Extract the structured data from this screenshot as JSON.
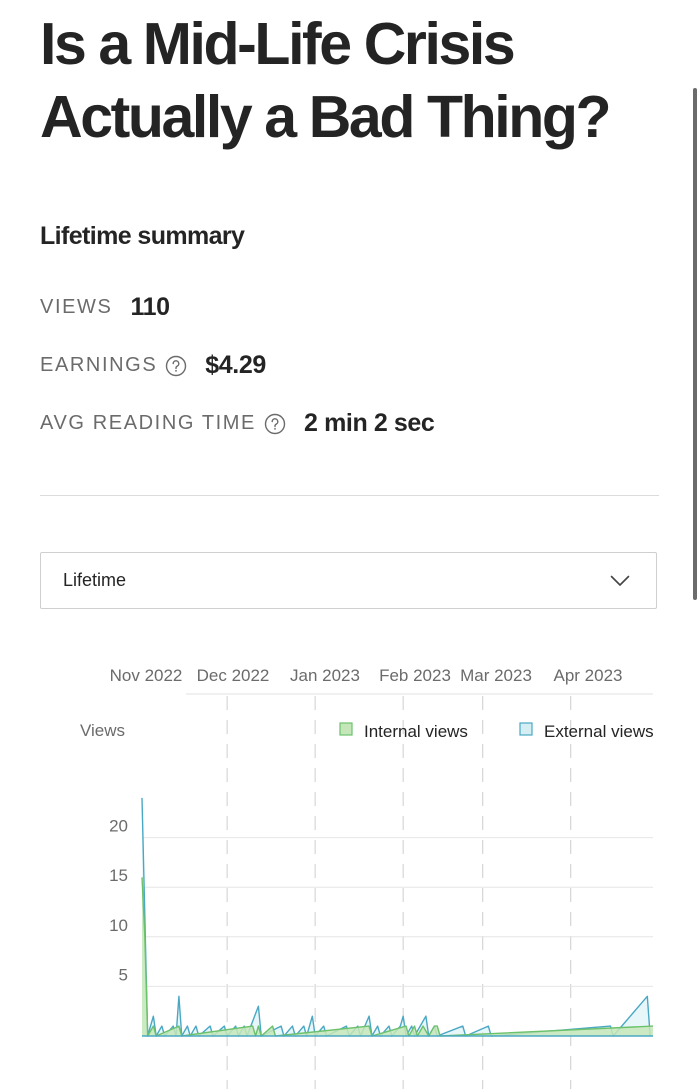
{
  "article": {
    "title": "Is a Mid-Life Crisis Actually a Bad Thing?"
  },
  "summary": {
    "heading": "Lifetime summary",
    "views_label": "VIEWS",
    "views_value": "110",
    "earnings_label": "EARNINGS",
    "earnings_value": "$4.29",
    "avg_label": "AVG READING TIME",
    "avg_value": "2 min 2 sec",
    "help_icon": "question-circle-icon"
  },
  "range_select": {
    "value": "Lifetime",
    "icon": "chevron-down-icon"
  },
  "colors": {
    "internal_fill": "#c5e6b8",
    "internal_stroke": "#6cc16c",
    "external_fill": "#d4eef4",
    "external_stroke": "#4aa8c4"
  },
  "chart_data": {
    "type": "area",
    "x_tick_labels": [
      "Nov 2022",
      "Dec 2022",
      "Jan 2023",
      "Feb 2023",
      "Mar 2023",
      "Apr 2023"
    ],
    "ylabel": "Views",
    "y_ticks": [
      5,
      10,
      15,
      20
    ],
    "ylim": [
      0,
      25
    ],
    "grid": true,
    "legend_position": "top-right",
    "x_start": "2022-11-01",
    "x_end": "2023-04-30",
    "series": [
      {
        "name": "Internal views",
        "points": [
          [
            "2022-11-01",
            16
          ],
          [
            "2022-11-02",
            10
          ],
          [
            "2022-11-03",
            0
          ],
          [
            "2022-11-05",
            1
          ],
          [
            "2022-11-06",
            0
          ],
          [
            "2022-11-14",
            1
          ],
          [
            "2022-11-15",
            0
          ],
          [
            "2022-12-10",
            1
          ],
          [
            "2022-12-11",
            0
          ],
          [
            "2022-12-12",
            1
          ],
          [
            "2022-12-13",
            0
          ],
          [
            "2022-12-17",
            1
          ],
          [
            "2022-12-18",
            0
          ],
          [
            "2023-01-20",
            1
          ],
          [
            "2023-01-21",
            0
          ],
          [
            "2023-02-02",
            1
          ],
          [
            "2023-02-03",
            0
          ],
          [
            "2023-02-05",
            1
          ],
          [
            "2023-02-06",
            0
          ],
          [
            "2023-02-08",
            1
          ],
          [
            "2023-02-10",
            0
          ],
          [
            "2023-02-12",
            1
          ],
          [
            "2023-02-13",
            1
          ],
          [
            "2023-02-14",
            0
          ],
          [
            "2023-04-30",
            1
          ]
        ]
      },
      {
        "name": "External views",
        "points": [
          [
            "2022-11-01",
            24
          ],
          [
            "2022-11-02",
            12
          ],
          [
            "2022-11-03",
            0
          ],
          [
            "2022-11-05",
            2
          ],
          [
            "2022-11-06",
            0
          ],
          [
            "2022-11-08",
            1
          ],
          [
            "2022-11-09",
            0
          ],
          [
            "2022-11-12",
            1
          ],
          [
            "2022-11-13",
            0
          ],
          [
            "2022-11-14",
            4
          ],
          [
            "2022-11-15",
            0
          ],
          [
            "2022-11-17",
            1
          ],
          [
            "2022-11-18",
            0
          ],
          [
            "2022-11-20",
            1
          ],
          [
            "2022-11-21",
            0
          ],
          [
            "2022-11-25",
            1
          ],
          [
            "2022-11-26",
            0
          ],
          [
            "2022-11-30",
            1
          ],
          [
            "2022-12-01",
            0
          ],
          [
            "2022-12-04",
            1
          ],
          [
            "2022-12-05",
            0
          ],
          [
            "2022-12-07",
            1
          ],
          [
            "2022-12-08",
            0
          ],
          [
            "2022-12-12",
            3
          ],
          [
            "2022-12-13",
            0
          ],
          [
            "2022-12-20",
            1
          ],
          [
            "2022-12-21",
            0
          ],
          [
            "2022-12-24",
            1
          ],
          [
            "2022-12-25",
            0
          ],
          [
            "2022-12-28",
            1
          ],
          [
            "2022-12-29",
            0
          ],
          [
            "2022-12-31",
            2
          ],
          [
            "2023-01-01",
            0
          ],
          [
            "2023-01-04",
            1
          ],
          [
            "2023-01-05",
            0
          ],
          [
            "2023-01-12",
            1
          ],
          [
            "2023-01-13",
            0
          ],
          [
            "2023-01-16",
            1
          ],
          [
            "2023-01-17",
            0
          ],
          [
            "2023-01-20",
            2
          ],
          [
            "2023-01-21",
            0
          ],
          [
            "2023-01-23",
            1
          ],
          [
            "2023-01-24",
            0
          ],
          [
            "2023-01-27",
            1
          ],
          [
            "2023-01-28",
            0
          ],
          [
            "2023-01-31",
            1
          ],
          [
            "2023-02-01",
            2
          ],
          [
            "2023-02-02",
            0
          ],
          [
            "2023-02-04",
            1
          ],
          [
            "2023-02-05",
            0
          ],
          [
            "2023-02-09",
            2
          ],
          [
            "2023-02-10",
            0
          ],
          [
            "2023-02-12",
            1
          ],
          [
            "2023-02-13",
            0
          ],
          [
            "2023-02-22",
            1
          ],
          [
            "2023-02-23",
            0
          ],
          [
            "2023-03-03",
            1
          ],
          [
            "2023-03-04",
            0
          ],
          [
            "2023-04-15",
            1
          ],
          [
            "2023-04-16",
            0
          ],
          [
            "2023-04-28",
            4
          ],
          [
            "2023-04-29",
            0
          ]
        ]
      }
    ]
  }
}
